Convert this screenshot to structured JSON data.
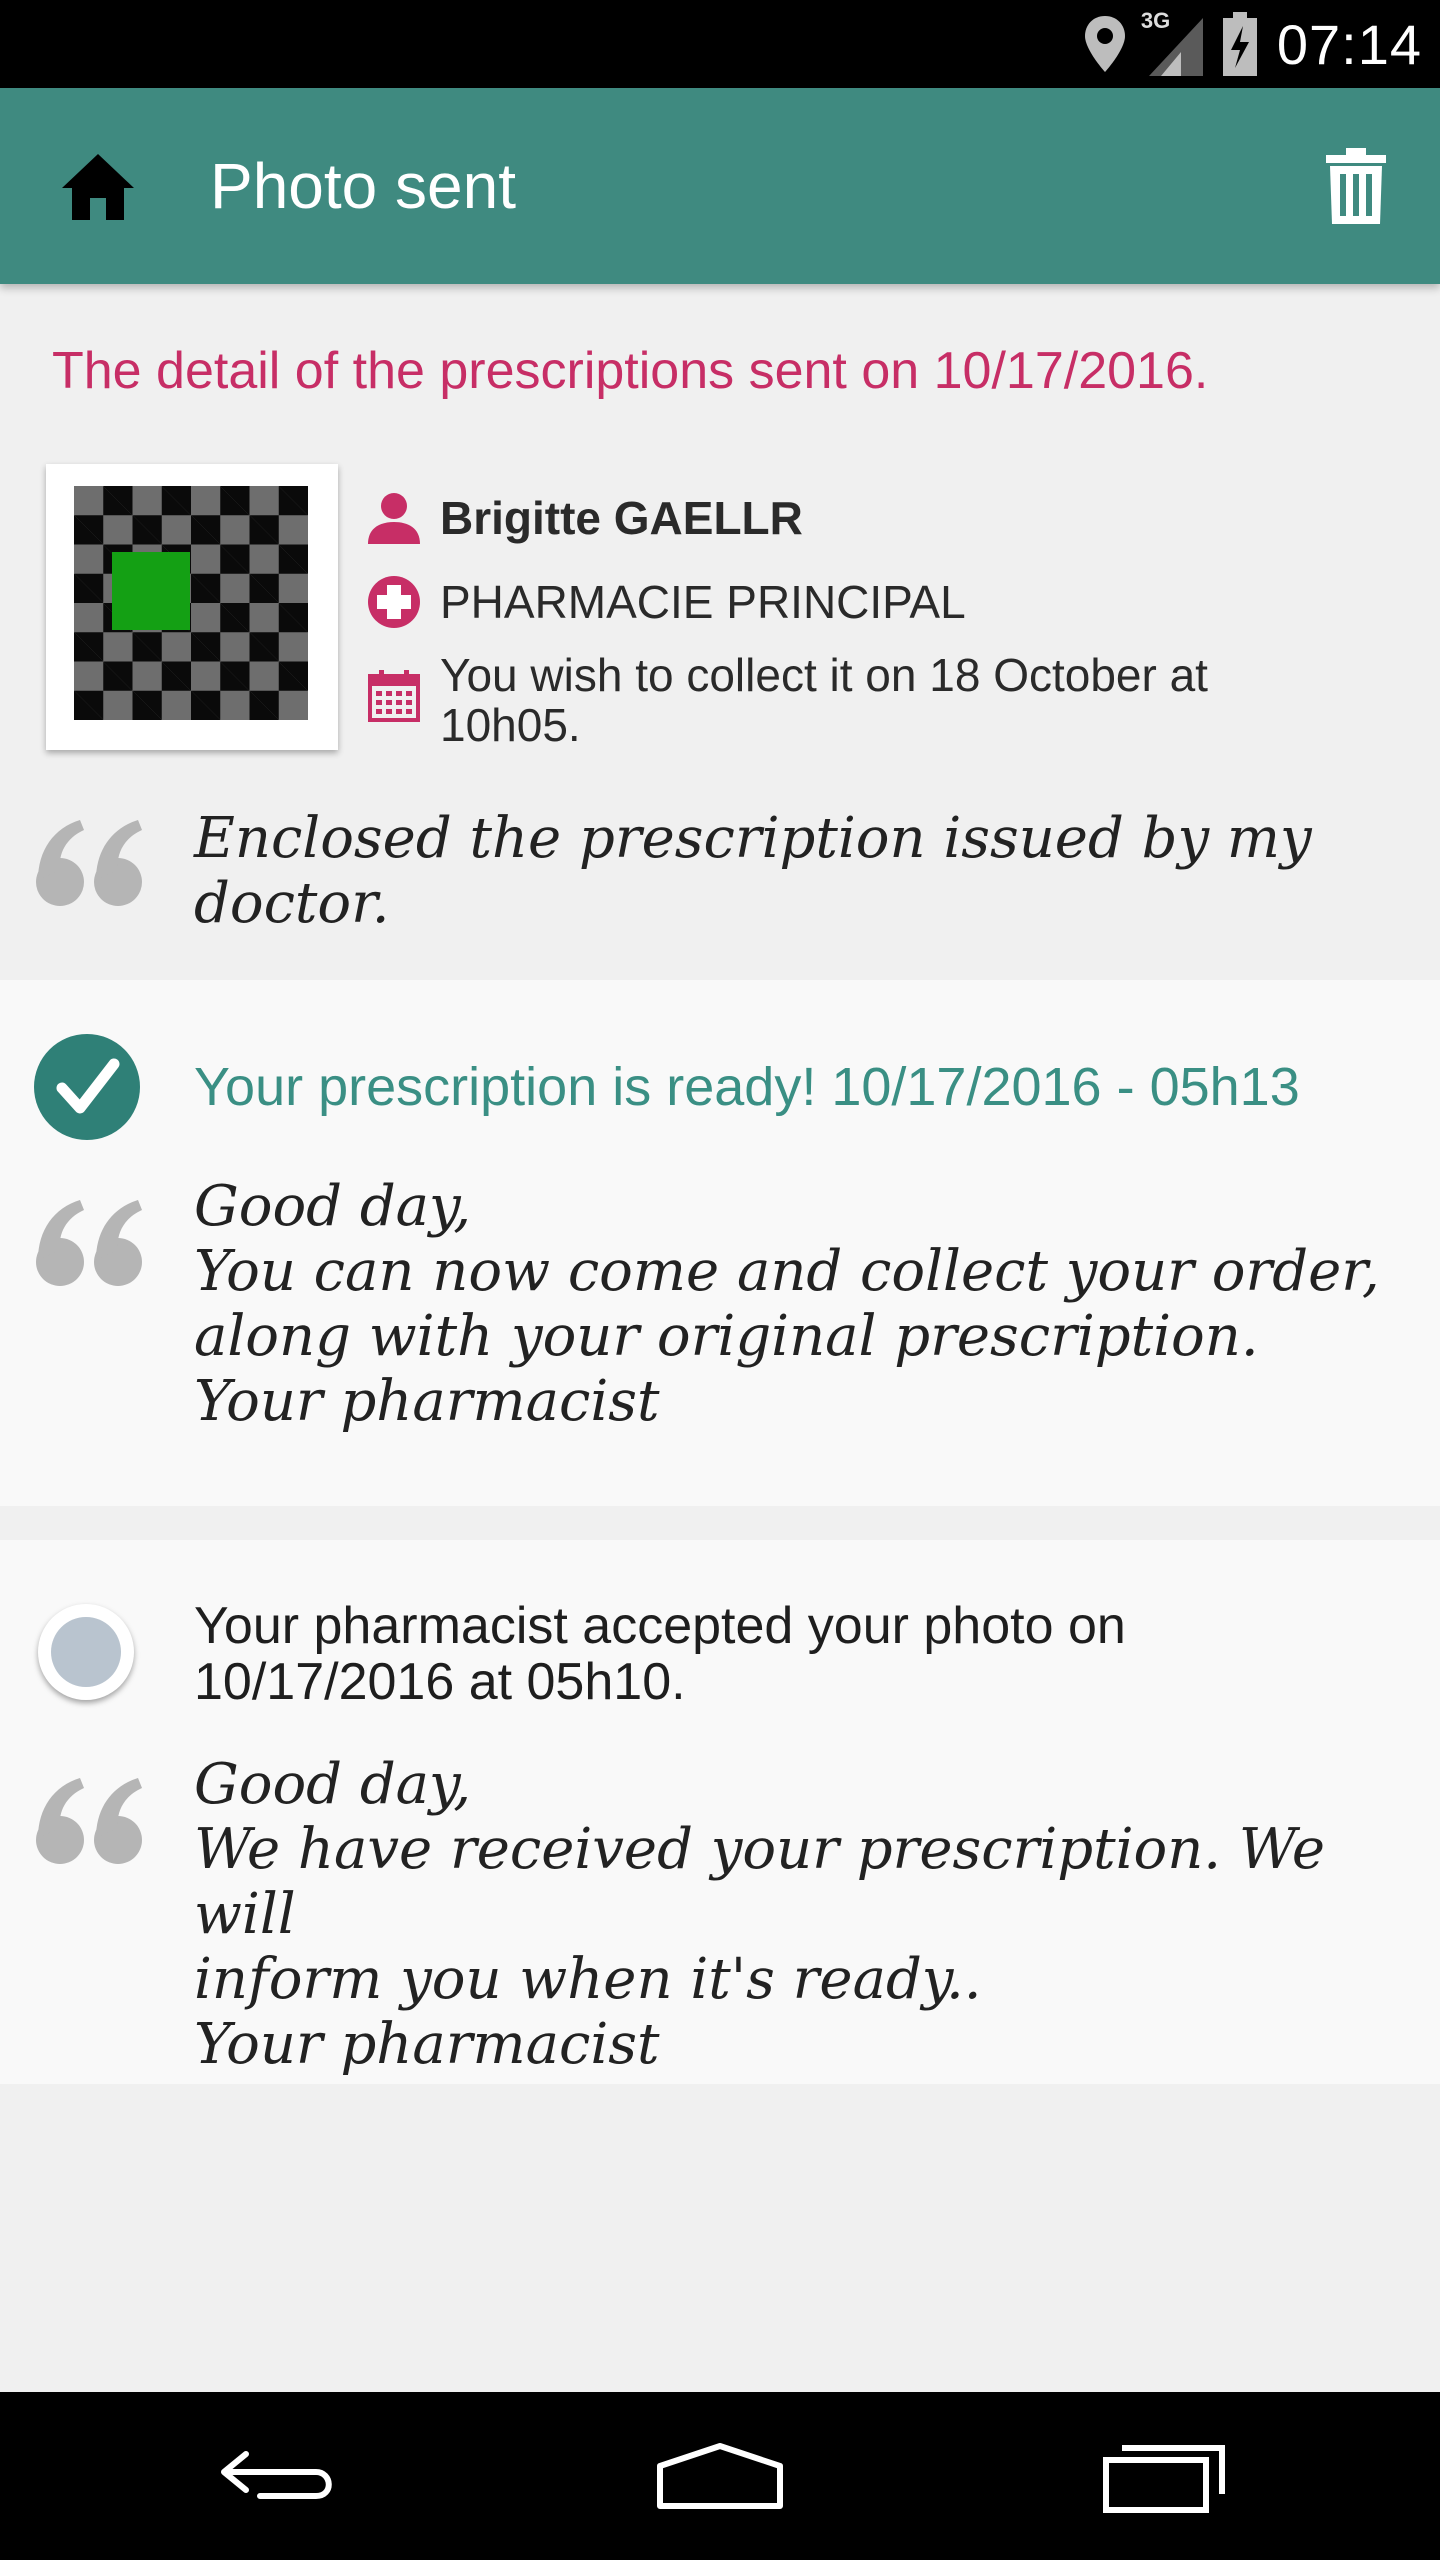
{
  "status_bar": {
    "time": "07:14",
    "network": "3G",
    "icons": [
      "location-icon",
      "signal-icon",
      "battery-icon"
    ]
  },
  "app_bar": {
    "title": "Photo sent",
    "icons": [
      "home-icon",
      "trash-icon"
    ],
    "color": "#3f8a80"
  },
  "header": {
    "detail_text": "The detail of the prescriptions sent on 10/17/2016.",
    "accent": "#c72e66"
  },
  "prescription": {
    "patient_name": "Brigitte GAELLR",
    "pharmacy": "PHARMACIE PRINCIPAL",
    "collect_info": "You wish to collect it on 18 October at 10h05.",
    "comment": "Enclosed the prescription issued by my doctor."
  },
  "updates": [
    {
      "status": "ready",
      "title": "Your prescription is ready! 10/17/2016 - 05h13",
      "message": "Good day,\nYou can now come and collect your order,\nalong with your original prescription.\nYour pharmacist",
      "color": "#3a8f84"
    },
    {
      "status": "accepted",
      "title": "Your pharmacist accepted your photo on 10/17/2016 at 05h10.",
      "message": "Good day,\nWe have received your prescription. We will\ninform you when it's ready..\nYour pharmacist"
    }
  ],
  "nav_bar": {
    "buttons": [
      "back-icon",
      "home-nav-icon",
      "recents-icon"
    ]
  }
}
